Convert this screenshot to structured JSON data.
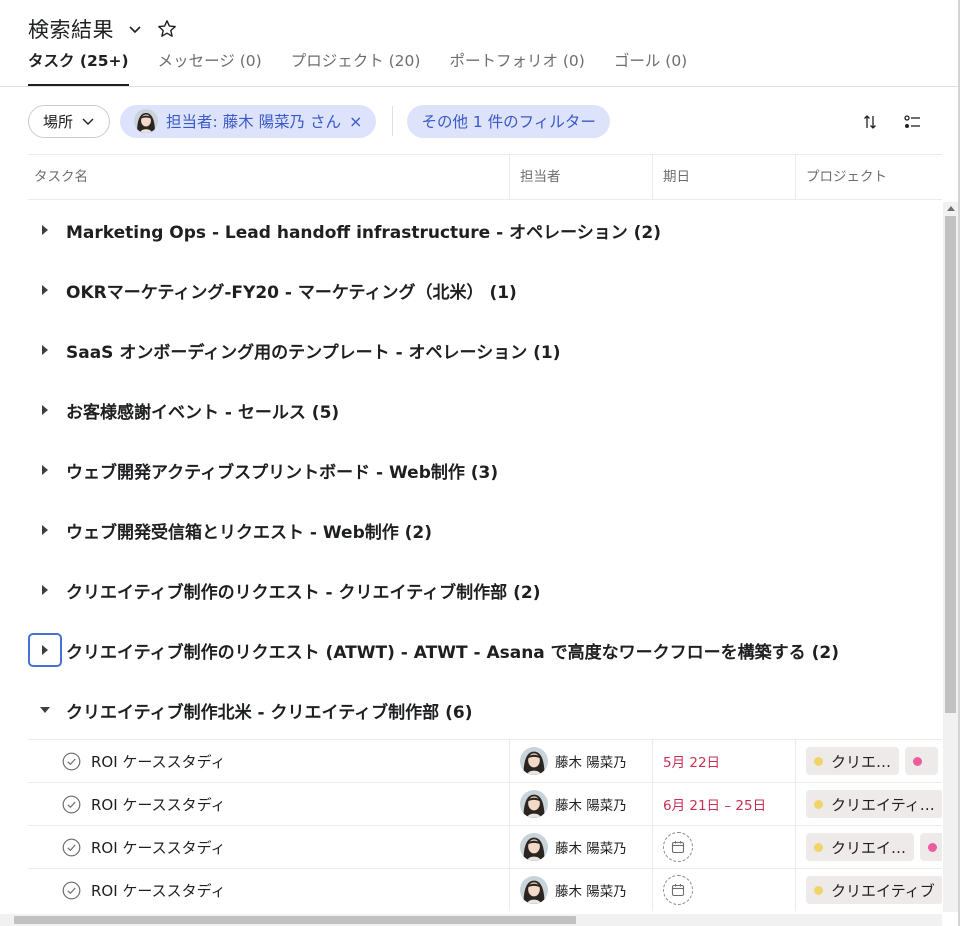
{
  "header": {
    "title": "検索結果"
  },
  "tabs": [
    {
      "label": "タスク (25+)",
      "active": true
    },
    {
      "label": "メッセージ (0)"
    },
    {
      "label": "プロジェクト (20)"
    },
    {
      "label": "ポートフォリオ (0)"
    },
    {
      "label": "ゴール (0)"
    }
  ],
  "filters": {
    "location_label": "場所",
    "assignee_label": "担当者: 藤木 陽菜乃 さん",
    "remove_symbol": "×",
    "more_label": "その他 1 件のフィルター"
  },
  "columns": {
    "task_name": "タスク名",
    "assignee": "担当者",
    "due": "期日",
    "project": "プロジェクト"
  },
  "groups": [
    {
      "label": "Marketing Ops - Lead handoff infrastructure - オペレーション (2)",
      "expanded": false
    },
    {
      "label": "OKRマーケティング-FY20 - マーケティング（北米） (1)",
      "expanded": false
    },
    {
      "label": "SaaS オンボーディング用のテンプレート - オペレーション (1)",
      "expanded": false
    },
    {
      "label": "お客様感謝イベント - セールス (5)",
      "expanded": false
    },
    {
      "label": "ウェブ開発アクティブスプリントボード - Web制作 (3)",
      "expanded": false
    },
    {
      "label": "ウェブ開発受信箱とリクエスト - Web制作 (2)",
      "expanded": false
    },
    {
      "label": "クリエイティブ制作のリクエスト - クリエイティブ制作部 (2)",
      "expanded": false
    },
    {
      "label": "クリエイティブ制作のリクエスト (ATWT) - ATWT - Asana で高度なワークフローを構築する (2)",
      "expanded": false,
      "focused": true
    },
    {
      "label": "クリエイティブ制作北米 - クリエイティブ制作部 (6)",
      "expanded": true
    }
  ],
  "tasks": [
    {
      "name": "ROI ケーススタディ",
      "assignee": "藤木 陽菜乃",
      "due": "5月 22日",
      "projects": [
        "クリエ…",
        ""
      ]
    },
    {
      "name": "ROI ケーススタディ",
      "assignee": "藤木 陽菜乃",
      "due": "6月 21日 – 25日",
      "projects": [
        "クリエイティ…"
      ]
    },
    {
      "name": "ROI ケーススタディ",
      "assignee": "藤木 陽菜乃",
      "due": "",
      "projects": [
        "クリエイ…",
        ""
      ]
    },
    {
      "name": "ROI ケーススタディ",
      "assignee": "藤木 陽菜乃",
      "due": "",
      "projects": [
        "クリエイティブ"
      ]
    }
  ],
  "colors": {
    "accent_blue": "#3b58c9",
    "chip_bg": "#dde3fb",
    "due_red": "#c92f54",
    "project_yellow": "#f1d469",
    "project_pink": "#ec5d9e",
    "focus_blue": "#4573d2"
  },
  "icons": {
    "title_menu": "chevron-down-icon",
    "favorite": "star-icon",
    "sort": "sort-arrows-icon",
    "options": "list-options-icon",
    "expand": "caret-right-icon",
    "collapse": "caret-down-icon",
    "complete": "check-circle-icon",
    "empty_due": "calendar-icon"
  }
}
